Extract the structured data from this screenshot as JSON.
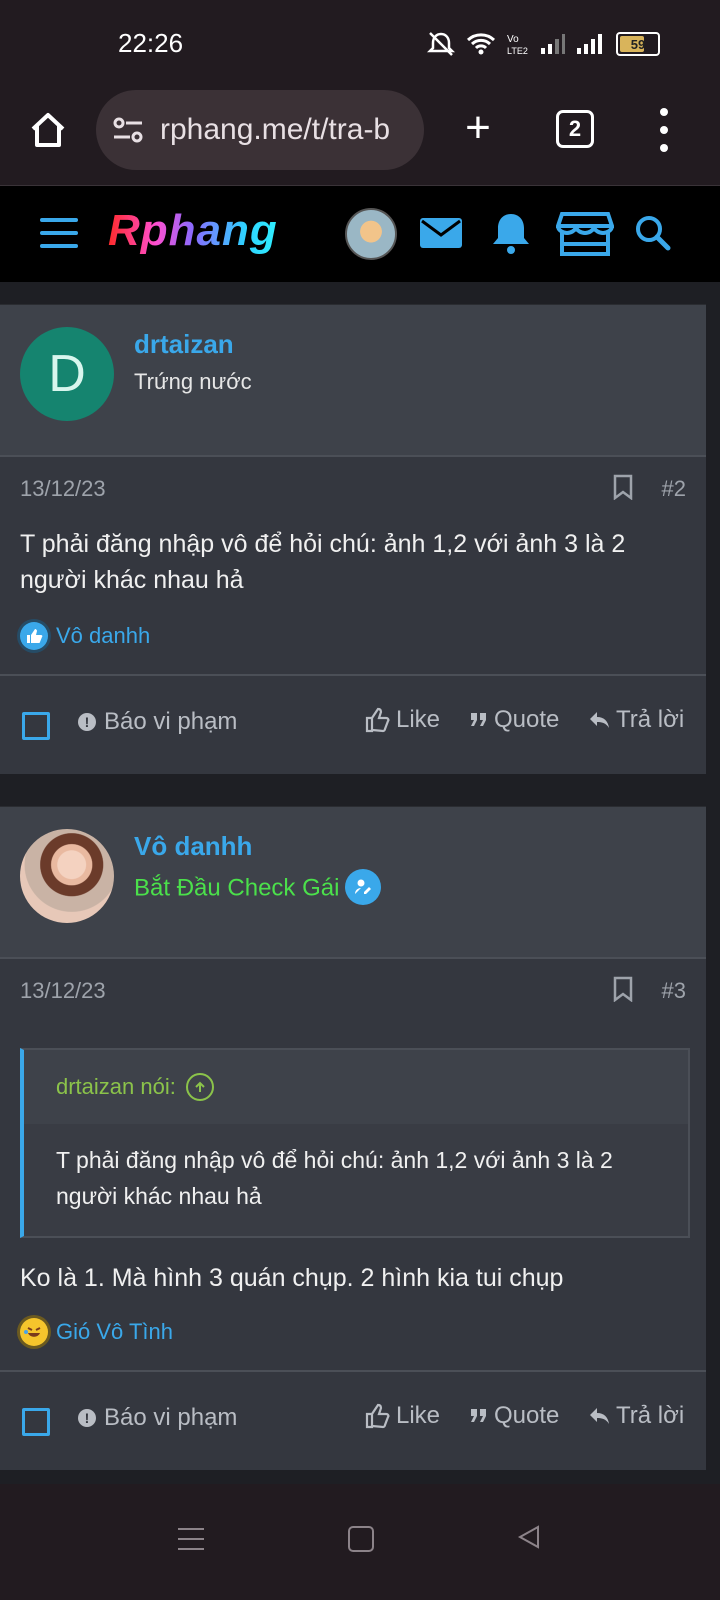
{
  "status_bar": {
    "time": "22:26",
    "battery": "59"
  },
  "browser": {
    "url": "rphang.me/t/tra-b",
    "tab_count": "2"
  },
  "site": {
    "logo": "Rphang"
  },
  "posts": [
    {
      "username": "drtaizan",
      "user_title": "Trứng nước",
      "avatar_letter": "D",
      "date": "13/12/23",
      "number": "#2",
      "body": "T phải đăng nhập vô để hỏi chú: ảnh 1,2 với ảnh 3 là 2 người khác nhau hả",
      "reaction_user": "Vô danhh",
      "reaction_icon": "thumbs-up-reaction-icon"
    },
    {
      "username": "Vô danhh",
      "user_title": "Bắt Đầu Check Gái",
      "date": "13/12/23",
      "number": "#3",
      "quote_author": "drtaizan nói:",
      "quote_text": "T phải đăng nhập vô để hỏi chú: ảnh 1,2 với ảnh 3 là 2 người khác nhau hả",
      "body": "Ko là 1. Mà hình 3 quán chụp. 2 hình kia tui chụp",
      "reaction_user": "Gió Vô Tình",
      "reaction_icon": "laughing-reaction-icon"
    }
  ],
  "post_actions": {
    "report": "Báo vi phạm",
    "like": "Like",
    "quote": "Quote",
    "reply": "Trả lời"
  },
  "colors": {
    "accent": "#3aa8ea",
    "user_title_green": "#4be04b",
    "quote_author": "#8bc34a",
    "avatar_d": "#15846f"
  }
}
